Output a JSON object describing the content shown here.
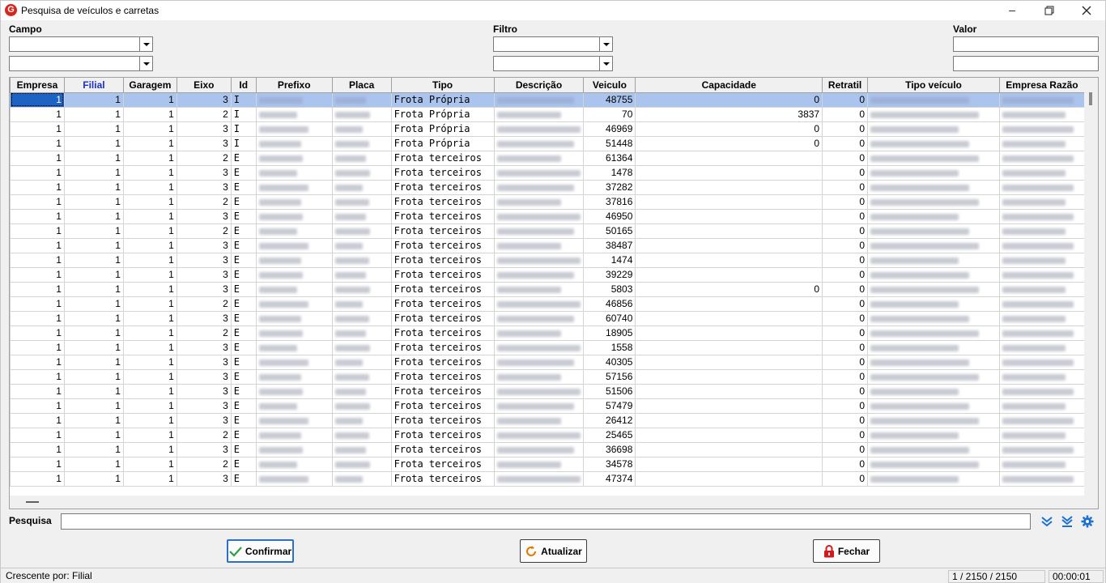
{
  "window": {
    "title": "Pesquisa de veículos e carretas"
  },
  "filters": {
    "campo_label": "Campo",
    "filtro_label": "Filtro",
    "valor_label": "Valor"
  },
  "grid": {
    "columns": [
      "Empresa",
      "Filial",
      "Garagem",
      "Eixo",
      "Id",
      "Prefixo",
      "Placa",
      "Tipo",
      "Descrição",
      "Veiculo",
      "Capacidade",
      "Retratil",
      "Tipo veículo",
      "Empresa Razão"
    ],
    "rows": [
      [
        "1",
        "1",
        "1",
        "3",
        "I",
        "",
        "",
        "Frota Própria",
        "",
        "48755",
        "0",
        "0",
        "",
        ""
      ],
      [
        "1",
        "1",
        "1",
        "2",
        "I",
        "",
        "",
        "Frota Própria",
        "",
        "70",
        "3837",
        "0",
        "",
        ""
      ],
      [
        "1",
        "1",
        "1",
        "3",
        "I",
        "",
        "",
        "Frota Própria",
        "",
        "46969",
        "0",
        "0",
        "",
        ""
      ],
      [
        "1",
        "1",
        "1",
        "3",
        "I",
        "",
        "",
        "Frota Própria",
        "",
        "51448",
        "0",
        "0",
        "",
        ""
      ],
      [
        "1",
        "1",
        "1",
        "2",
        "E",
        "",
        "",
        "Frota terceiros",
        "",
        "61364",
        "",
        "0",
        "",
        ""
      ],
      [
        "1",
        "1",
        "1",
        "3",
        "E",
        "",
        "",
        "Frota terceiros",
        "",
        "1478",
        "",
        "0",
        "",
        ""
      ],
      [
        "1",
        "1",
        "1",
        "3",
        "E",
        "",
        "",
        "Frota terceiros",
        "",
        "37282",
        "",
        "0",
        "",
        ""
      ],
      [
        "1",
        "1",
        "1",
        "2",
        "E",
        "",
        "",
        "Frota terceiros",
        "",
        "37816",
        "",
        "0",
        "",
        ""
      ],
      [
        "1",
        "1",
        "1",
        "3",
        "E",
        "",
        "",
        "Frota terceiros",
        "",
        "46950",
        "",
        "0",
        "",
        ""
      ],
      [
        "1",
        "1",
        "1",
        "2",
        "E",
        "",
        "",
        "Frota terceiros",
        "",
        "50165",
        "",
        "0",
        "",
        ""
      ],
      [
        "1",
        "1",
        "1",
        "3",
        "E",
        "",
        "",
        "Frota terceiros",
        "",
        "38487",
        "",
        "0",
        "",
        ""
      ],
      [
        "1",
        "1",
        "1",
        "3",
        "E",
        "",
        "",
        "Frota terceiros",
        "",
        "1474",
        "",
        "0",
        "",
        ""
      ],
      [
        "1",
        "1",
        "1",
        "3",
        "E",
        "",
        "",
        "Frota terceiros",
        "",
        "39229",
        "",
        "0",
        "",
        ""
      ],
      [
        "1",
        "1",
        "1",
        "3",
        "E",
        "",
        "",
        "Frota terceiros",
        "",
        "5803",
        "0",
        "0",
        "",
        ""
      ],
      [
        "1",
        "1",
        "1",
        "2",
        "E",
        "",
        "",
        "Frota terceiros",
        "",
        "46856",
        "",
        "0",
        "",
        ""
      ],
      [
        "1",
        "1",
        "1",
        "3",
        "E",
        "",
        "",
        "Frota terceiros",
        "",
        "60740",
        "",
        "0",
        "",
        ""
      ],
      [
        "1",
        "1",
        "1",
        "2",
        "E",
        "",
        "",
        "Frota terceiros",
        "",
        "18905",
        "",
        "0",
        "",
        ""
      ],
      [
        "1",
        "1",
        "1",
        "3",
        "E",
        "",
        "",
        "Frota terceiros",
        "",
        "1558",
        "",
        "0",
        "",
        ""
      ],
      [
        "1",
        "1",
        "1",
        "3",
        "E",
        "",
        "",
        "Frota terceiros",
        "",
        "40305",
        "",
        "0",
        "",
        ""
      ],
      [
        "1",
        "1",
        "1",
        "3",
        "E",
        "",
        "",
        "Frota terceiros",
        "",
        "57156",
        "",
        "0",
        "",
        ""
      ],
      [
        "1",
        "1",
        "1",
        "3",
        "E",
        "",
        "",
        "Frota terceiros",
        "",
        "51506",
        "",
        "0",
        "",
        ""
      ],
      [
        "1",
        "1",
        "1",
        "3",
        "E",
        "",
        "",
        "Frota terceiros",
        "",
        "57479",
        "",
        "0",
        "",
        ""
      ],
      [
        "1",
        "1",
        "1",
        "3",
        "E",
        "",
        "",
        "Frota terceiros",
        "",
        "26412",
        "",
        "0",
        "",
        ""
      ],
      [
        "1",
        "1",
        "1",
        "2",
        "E",
        "",
        "",
        "Frota terceiros",
        "",
        "25465",
        "",
        "0",
        "",
        ""
      ],
      [
        "1",
        "1",
        "1",
        "3",
        "E",
        "",
        "",
        "Frota terceiros",
        "",
        "36698",
        "",
        "0",
        "",
        ""
      ],
      [
        "1",
        "1",
        "1",
        "2",
        "E",
        "",
        "",
        "Frota terceiros",
        "",
        "34578",
        "",
        "0",
        "",
        ""
      ],
      [
        "1",
        "1",
        "1",
        "3",
        "E",
        "",
        "",
        "Frota terceiros",
        "",
        "47374",
        "",
        "0",
        "",
        ""
      ]
    ]
  },
  "search": {
    "label": "Pesquisa",
    "value": ""
  },
  "buttons": {
    "confirmar": "Confirmar",
    "atualizar": "Atualizar",
    "fechar": "Fechar"
  },
  "status": {
    "sort": "Crescente por:  Filial",
    "count": "1 / 2150 / 2150",
    "time": "00:00:01"
  },
  "colors": {
    "selection": "#aac4ee",
    "focus": "#1c63c4",
    "accent": "#2b6fc9",
    "filial_header": "#1a30c8"
  }
}
